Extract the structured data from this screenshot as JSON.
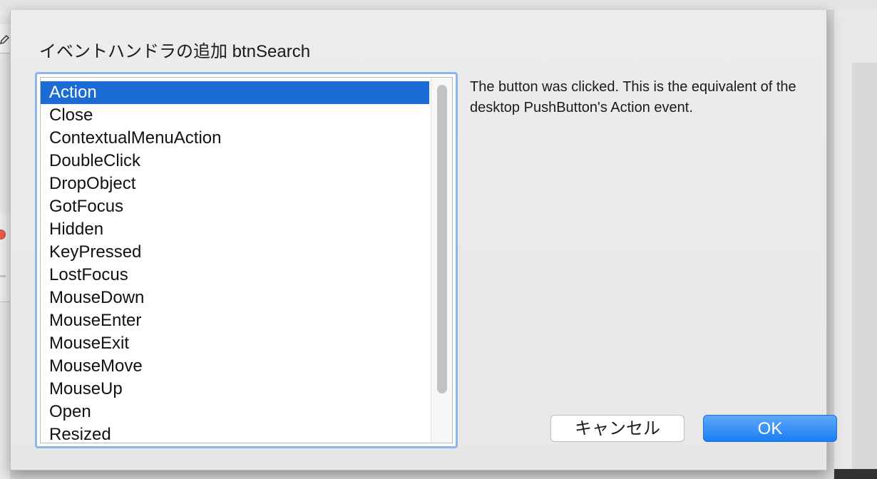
{
  "dialog": {
    "title": "イベントハンドラの追加 btnSearch",
    "description": "The button was clicked. This is the equivalent of the desktop PushButton's Action event.",
    "selected_index": 0,
    "events": [
      "Action",
      "Close",
      "ContextualMenuAction",
      "DoubleClick",
      "DropObject",
      "GotFocus",
      "Hidden",
      "KeyPressed",
      "LostFocus",
      "MouseDown",
      "MouseEnter",
      "MouseExit",
      "MouseMove",
      "MouseUp",
      "Open",
      "Resized"
    ],
    "cancel_label": "キャンセル",
    "ok_label": "OK"
  },
  "colors": {
    "selection": "#1b6bd4",
    "default_button": "#1a7ef3",
    "focus_ring": "#8db7ec"
  },
  "icons": {
    "background_tool": "pencil-icon",
    "window_close": "close-icon"
  }
}
